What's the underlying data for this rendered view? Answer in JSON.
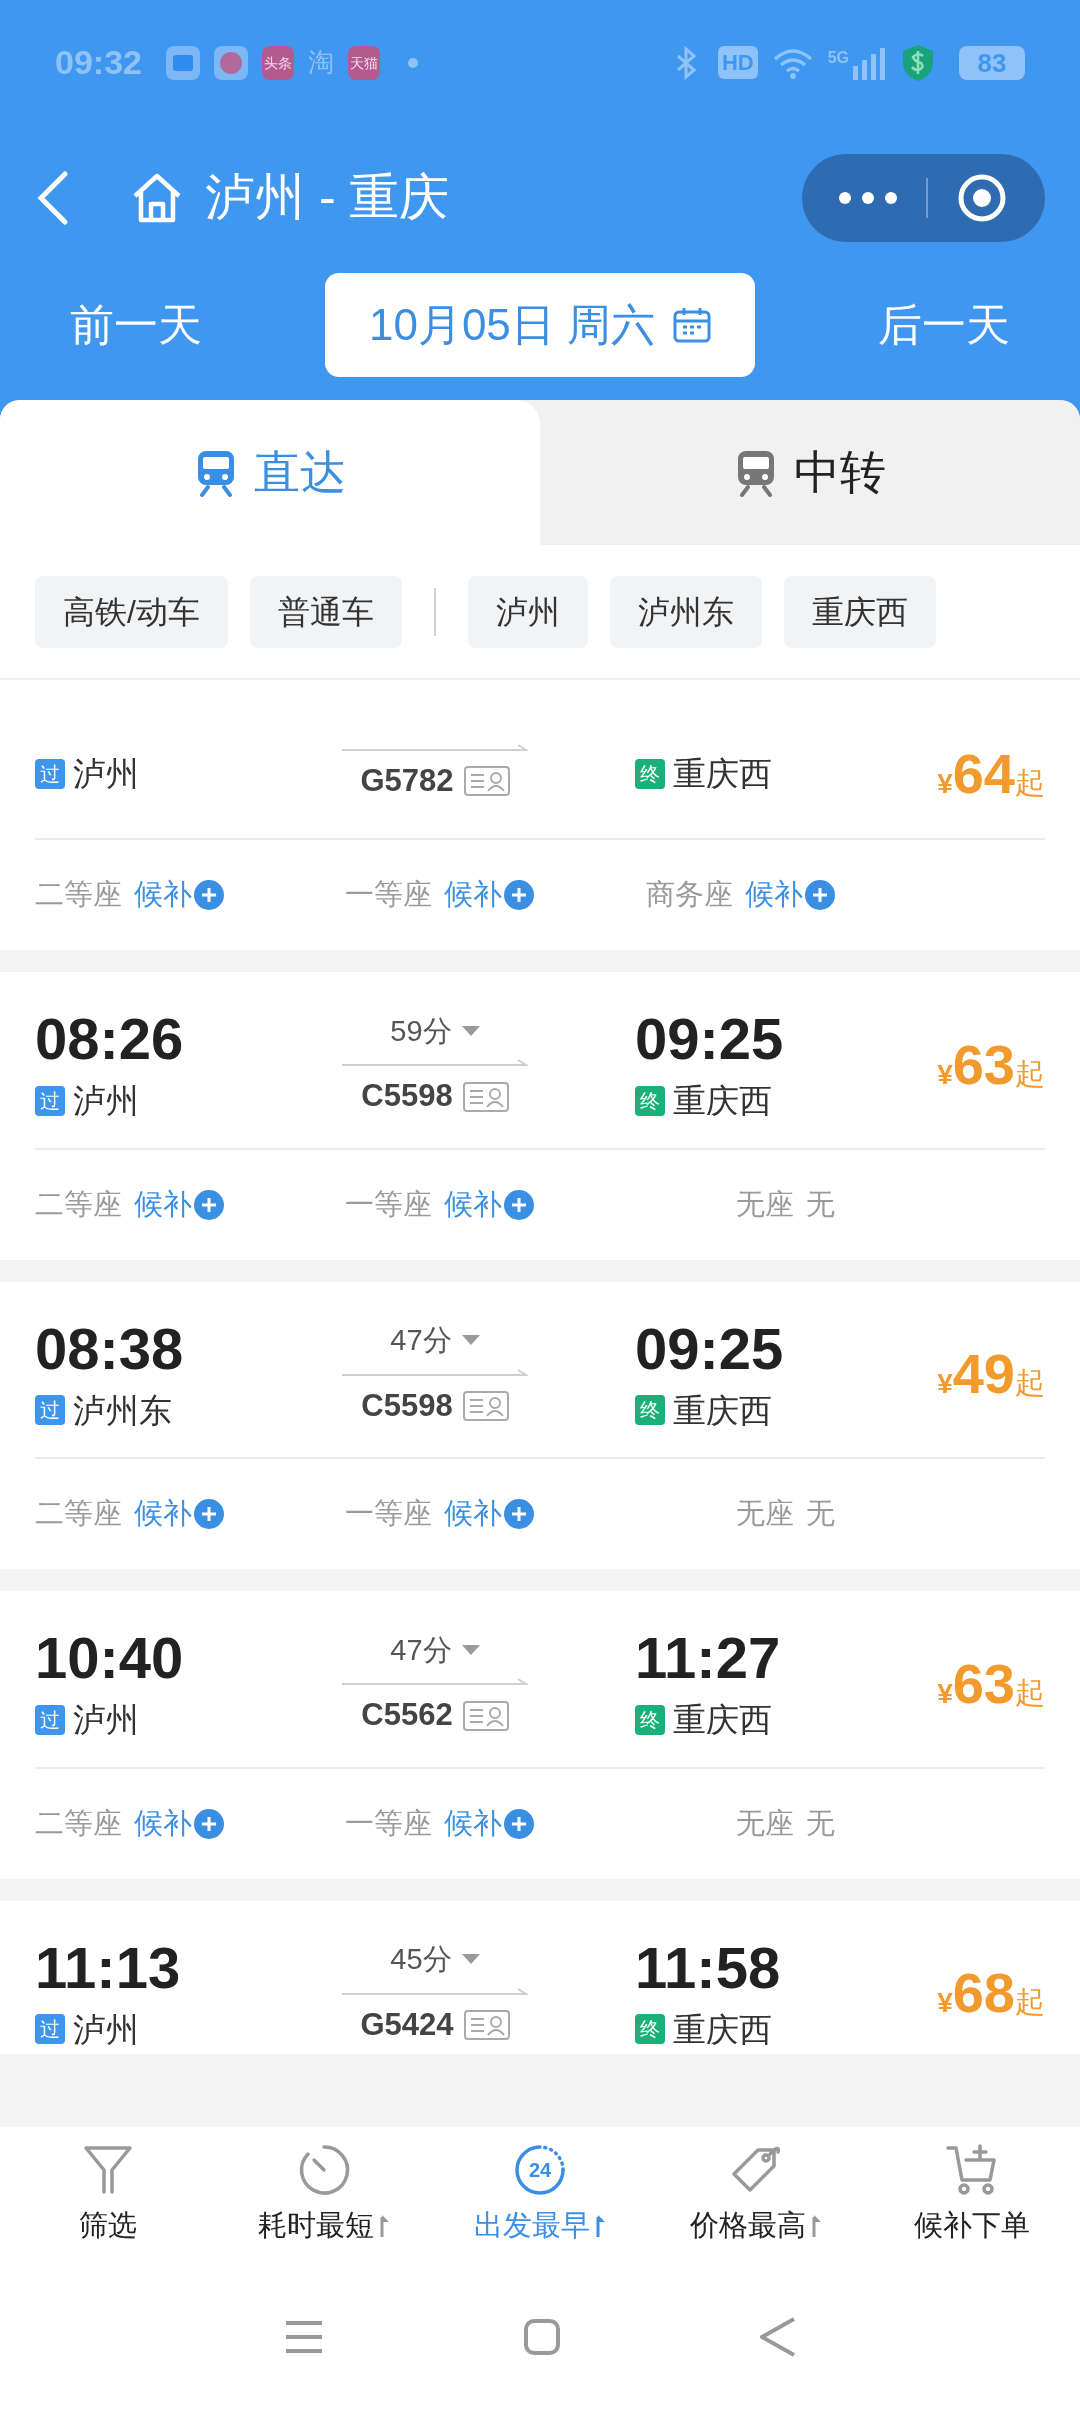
{
  "status_bar": {
    "time": "09:32",
    "app_icons": [
      {
        "kind": "square"
      },
      {
        "kind": "play"
      },
      {
        "kind": "text",
        "label": "头条"
      },
      {
        "kind": "plain",
        "label": "淘"
      },
      {
        "kind": "text",
        "label": "天猫"
      }
    ],
    "hd": "HD",
    "network": "5G",
    "battery": "83"
  },
  "header": {
    "title": "泸州 - 重庆",
    "prev_day": "前一天",
    "date": "10月05日 周六",
    "next_day": "后一天"
  },
  "tabs": [
    {
      "label": "直达",
      "selected": true
    },
    {
      "label": "中转",
      "selected": false
    }
  ],
  "filters": {
    "train_types": [
      {
        "label": "高铁/动车"
      },
      {
        "label": "普通车"
      }
    ],
    "stations": [
      {
        "label": "泸州"
      },
      {
        "label": "泸州东"
      },
      {
        "label": "重庆西"
      }
    ]
  },
  "trains": [
    {
      "number": "G5782",
      "from_tag": "过",
      "from": "泸州",
      "to_tag": "终",
      "to": "重庆西",
      "currency": "¥",
      "price": "64",
      "price_suffix": "起",
      "seats": [
        {
          "name": "二等座",
          "status": "候补",
          "waitlist": true
        },
        {
          "name": "一等座",
          "status": "候补",
          "waitlist": true
        },
        {
          "name": "商务座",
          "status": "候补",
          "waitlist": true
        }
      ]
    },
    {
      "dep_time": "08:26",
      "duration": "59分",
      "number": "C5598",
      "from_tag": "过",
      "from": "泸州",
      "arr_time": "09:25",
      "to_tag": "终",
      "to": "重庆西",
      "currency": "¥",
      "price": "63",
      "price_suffix": "起",
      "seats": [
        {
          "name": "二等座",
          "status": "候补",
          "waitlist": true
        },
        {
          "name": "一等座",
          "status": "候补",
          "waitlist": true
        },
        {
          "name": "无座",
          "status": "无",
          "waitlist": false
        }
      ]
    },
    {
      "dep_time": "08:38",
      "duration": "47分",
      "number": "C5598",
      "from_tag": "过",
      "from": "泸州东",
      "arr_time": "09:25",
      "to_tag": "终",
      "to": "重庆西",
      "currency": "¥",
      "price": "49",
      "price_suffix": "起",
      "seats": [
        {
          "name": "二等座",
          "status": "候补",
          "waitlist": true
        },
        {
          "name": "一等座",
          "status": "候补",
          "waitlist": true
        },
        {
          "name": "无座",
          "status": "无",
          "waitlist": false
        }
      ]
    },
    {
      "dep_time": "10:40",
      "duration": "47分",
      "number": "C5562",
      "from_tag": "过",
      "from": "泸州",
      "arr_time": "11:27",
      "to_tag": "终",
      "to": "重庆西",
      "currency": "¥",
      "price": "63",
      "price_suffix": "起",
      "seats": [
        {
          "name": "二等座",
          "status": "候补",
          "waitlist": true
        },
        {
          "name": "一等座",
          "status": "候补",
          "waitlist": true
        },
        {
          "name": "无座",
          "status": "无",
          "waitlist": false
        }
      ]
    },
    {
      "dep_time": "11:13",
      "duration": "45分",
      "number": "G5424",
      "from_tag": "过",
      "from": "泸州",
      "arr_time": "11:58",
      "to_tag": "终",
      "to": "重庆西",
      "currency": "¥",
      "price": "68",
      "price_suffix": "起"
    }
  ],
  "bottom_bar": [
    {
      "kind": "filter",
      "label": "筛选",
      "selected": false,
      "sortable": false
    },
    {
      "kind": "timer",
      "label": "耗时最短",
      "selected": false,
      "sortable": true
    },
    {
      "kind": "clock24",
      "icon_text": "24",
      "label": "出发最早",
      "selected": true,
      "sortable": true
    },
    {
      "kind": "tag",
      "label": "价格最高",
      "selected": false,
      "sortable": true
    },
    {
      "kind": "cart",
      "label": "候补下单",
      "selected": false,
      "sortable": false
    }
  ]
}
